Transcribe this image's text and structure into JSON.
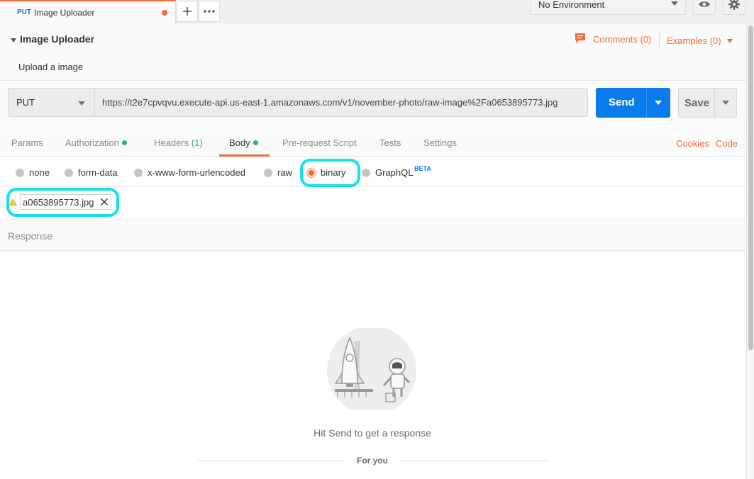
{
  "tabbar": {
    "active_tab": {
      "method": "PUT",
      "name": "Image Uploader"
    },
    "new_tab_icon": "plus-icon",
    "more_icon": "ellipsis-icon",
    "environment": "No Environment",
    "eye_icon": "eye-icon",
    "settings_icon": "gear-icon"
  },
  "request": {
    "title": "Image Uploader",
    "description": "Upload a image",
    "comments_label": "Comments (0)",
    "examples_label": "Examples (0)",
    "method": "PUT",
    "url": "https://t2e7cpvqvu.execute-api.us-east-1.amazonaws.com/v1/november-photo/raw-image%2Fa0653895773.jpg",
    "send_label": "Send",
    "save_label": "Save"
  },
  "tabs": {
    "params": "Params",
    "authorization": "Authorization",
    "headers": "Headers",
    "headers_count": "(1)",
    "body": "Body",
    "prerequest": "Pre-request Script",
    "tests": "Tests",
    "settings": "Settings",
    "cookies": "Cookies",
    "code": "Code"
  },
  "body_types": {
    "none": "none",
    "form_data": "form-data",
    "urlencoded": "x-www-form-urlencoded",
    "raw": "raw",
    "binary": "binary",
    "graphql": "GraphQL",
    "beta": "BETA",
    "selected": "binary"
  },
  "file": {
    "name": "a0653895773.jpg"
  },
  "response": {
    "label": "Response",
    "empty_message": "Hit Send to get a response",
    "for_you": "For you"
  },
  "colors": {
    "accent": "#f26b3a",
    "primary": "#097bed",
    "highlight": "#13e0ea",
    "success": "#26b47f"
  }
}
